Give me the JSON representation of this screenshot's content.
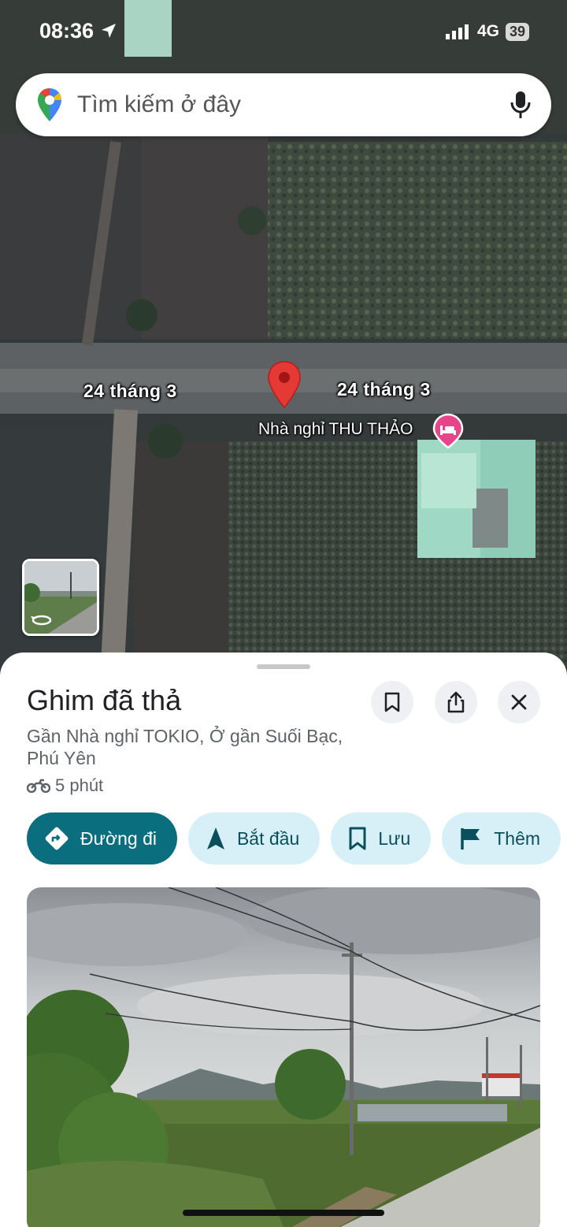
{
  "status_bar": {
    "time": "08:36",
    "network": "4G",
    "battery": "39",
    "icons": [
      "location-arrow-icon",
      "signal-icon",
      "battery-icon"
    ]
  },
  "search": {
    "placeholder": "Tìm kiếm ở đây",
    "icons": [
      "google-maps-logo-icon",
      "microphone-icon"
    ]
  },
  "map": {
    "roads": [
      {
        "label": "24 tháng 3"
      },
      {
        "label": "24 tháng 3"
      }
    ],
    "poi": {
      "label": "Nhà nghỉ THU THẢO",
      "icon": "bed-icon",
      "color": "#e8448a"
    },
    "pin": {
      "icon": "map-pin-icon",
      "color": "#e53935"
    },
    "street_view_thumbnail": {
      "icon": "street-view-rotate-icon"
    }
  },
  "place": {
    "title": "Ghim đã thả",
    "address": "Gần Nhà nghỉ TOKIO, Ở gần Suối Bạc, Phú Yên",
    "eta": {
      "icon": "motorbike-icon",
      "text": "5 phút"
    },
    "header_buttons": [
      "bookmark-icon",
      "share-icon",
      "close-icon"
    ]
  },
  "actions": [
    {
      "label": "Đường đi",
      "icon": "directions-icon",
      "primary": true
    },
    {
      "label": "Bắt đầu",
      "icon": "navigation-arrow-icon",
      "primary": false
    },
    {
      "label": "Lưu",
      "icon": "bookmark-icon",
      "primary": false
    },
    {
      "label": "Thêm",
      "icon": "flag-icon",
      "primary": false
    }
  ],
  "colors": {
    "primary": "#0b6e7f",
    "chip_bg": "#d7f0f7",
    "chip_text": "#0b4f5c"
  }
}
